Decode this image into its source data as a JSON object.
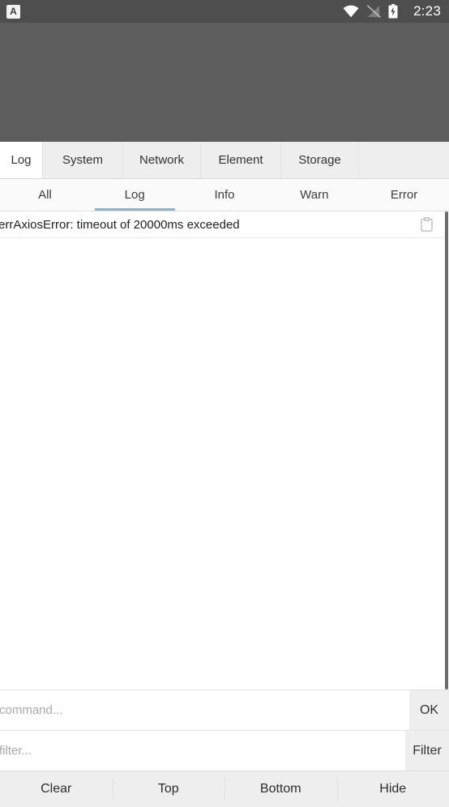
{
  "statusbar": {
    "app_badge_label": "A",
    "clock": "2:23",
    "icons": [
      "wifi-icon",
      "signal-off-icon",
      "battery-charging-icon"
    ]
  },
  "tabs": {
    "items": [
      {
        "label": "Log",
        "active": true
      },
      {
        "label": "System",
        "active": false
      },
      {
        "label": "Network",
        "active": false
      },
      {
        "label": "Element",
        "active": false
      },
      {
        "label": "Storage",
        "active": false
      }
    ]
  },
  "subtabs": {
    "items": [
      {
        "label": "All",
        "active": false
      },
      {
        "label": "Log",
        "active": true
      },
      {
        "label": "Info",
        "active": false
      },
      {
        "label": "Warn",
        "active": false
      },
      {
        "label": "Error",
        "active": false
      }
    ],
    "indicator_color": "#83b5d9"
  },
  "log": {
    "entries": [
      {
        "text": "errAxiosError: timeout of 20000ms exceeded",
        "copy_icon": "clipboard-icon"
      }
    ]
  },
  "command_row": {
    "placeholder": "command...",
    "value": "",
    "button_label": "OK"
  },
  "filter_row": {
    "placeholder": "filter...",
    "value": "",
    "button_label": "Filter"
  },
  "bottombar": {
    "buttons": [
      {
        "label": "Clear"
      },
      {
        "label": "Top"
      },
      {
        "label": "Bottom"
      },
      {
        "label": "Hide"
      }
    ]
  },
  "colors": {
    "statusbar_bg": "#4e4e4e",
    "webview_bg": "#5d5d5d",
    "accent": "#83b5d9",
    "chrome_bg": "#eeeeee"
  }
}
